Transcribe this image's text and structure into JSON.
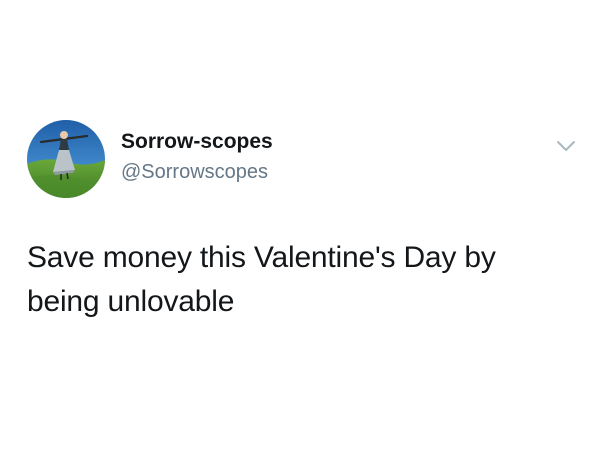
{
  "tweet": {
    "display_name": "Sorrow-scopes",
    "handle": "@Sorrowscopes",
    "text": "Save money this Valentine's Day by being unlovable",
    "avatar_icon": "profile-photo-avatar",
    "menu_icon": "chevron-down-icon"
  },
  "colors": {
    "text_primary": "#14171a",
    "text_secondary": "#657786",
    "caret": "#aab8c2"
  }
}
